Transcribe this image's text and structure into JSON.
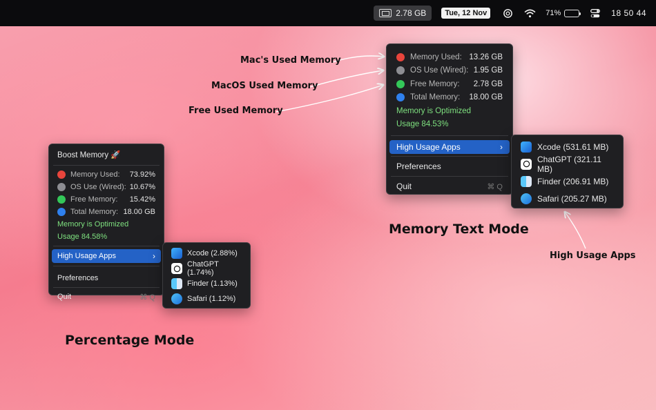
{
  "menubar": {
    "memory": "2.78 GB",
    "date": "Tue, 12 Nov",
    "battery": "71%",
    "battery_level": 0.71,
    "clock": "18 50 44",
    "icons": [
      "memory-chip-icon",
      "chatgpt-icon",
      "wifi-icon",
      "battery-icon",
      "control-center-icon"
    ]
  },
  "percentage_menu": {
    "title": "Boost Memory 🚀",
    "rows": [
      {
        "label": "Memory Used:",
        "value": "73.92%",
        "color": "#e8453c"
      },
      {
        "label": "OS Use (Wired):",
        "value": "10.67%",
        "color": "#8e8e93"
      },
      {
        "label": "Free Memory:",
        "value": "15.42%",
        "color": "#34c759"
      },
      {
        "label": "Total Memory:",
        "value": "18.00 GB",
        "color": "#2f80ed"
      }
    ],
    "status": "Memory is Optimized",
    "usage": "Usage 84.58%",
    "high_usage": "High Usage Apps",
    "preferences": "Preferences",
    "quit": "Quit",
    "quit_shortcut": "⌘ Q",
    "apps": [
      "Xcode (2.88%)",
      "ChatGPT (1.74%)",
      "Finder (1.13%)",
      "Safari (1.12%)"
    ]
  },
  "text_menu": {
    "rows": [
      {
        "label": "Memory Used:",
        "value": "13.26 GB",
        "color": "#e8453c"
      },
      {
        "label": "OS Use (Wired):",
        "value": "1.95 GB",
        "color": "#8e8e93"
      },
      {
        "label": "Free Memory:",
        "value": "2.78 GB",
        "color": "#34c759"
      },
      {
        "label": "Total Memory:",
        "value": "18.00 GB",
        "color": "#2f80ed"
      }
    ],
    "status": "Memory is Optimized",
    "usage": "Usage 84.53%",
    "high_usage": "High Usage Apps",
    "preferences": "Preferences",
    "quit": "Quit",
    "quit_shortcut": "⌘ Q",
    "apps": [
      "Xcode (531.61 MB)",
      "ChatGPT (321.11 MB)",
      "Finder (206.91 MB)",
      "Safari (205.27 MB)"
    ]
  },
  "annotations": {
    "macs_used": "Mac's Used Memory",
    "macos_used": "MacOS Used Memory",
    "free_used": "Free Used Memory",
    "text_mode": "Memory Text Mode",
    "high_usage": "High Usage Apps",
    "percentage_mode": "Percentage Mode"
  }
}
